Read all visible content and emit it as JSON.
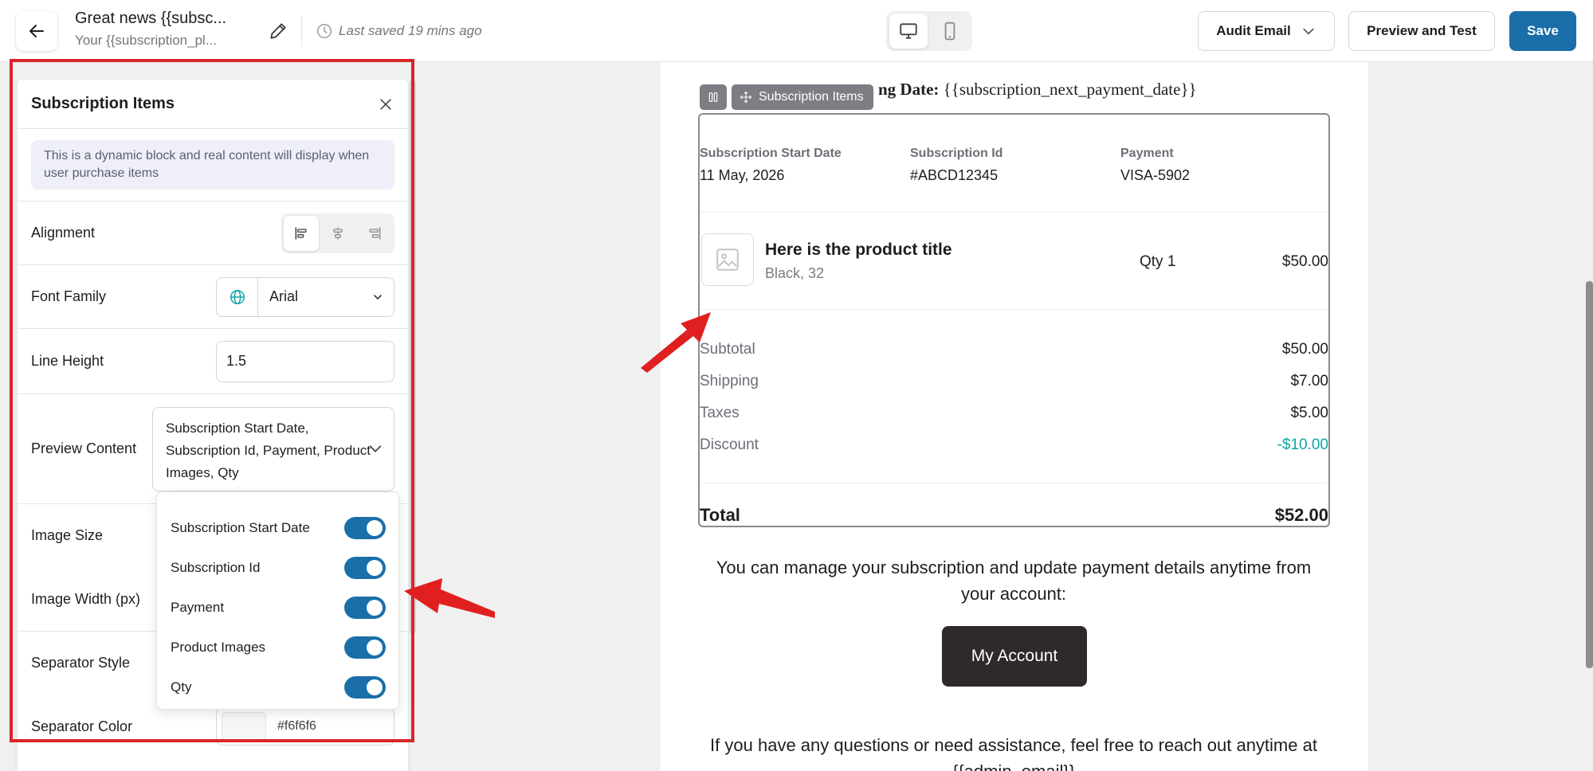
{
  "topbar": {
    "title": "Great news {{subsc...",
    "subtitle": "Your {{subscription_pl...",
    "saved": "Last saved 19 mins ago",
    "audit_label": "Audit Email",
    "preview_label": "Preview and Test",
    "save_label": "Save"
  },
  "panel": {
    "title": "Subscription Items",
    "info": "This is a dynamic block and real content will display when user purchase items",
    "alignment_label": "Alignment",
    "font_family_label": "Font Family",
    "font_family_value": "Arial",
    "line_height_label": "Line Height",
    "line_height_value": "1.5",
    "preview_content_label": "Preview Content",
    "preview_content_value": "Subscription Start Date, Subscription Id, Payment, Product Images, Qty",
    "image_size_label": "Image Size",
    "image_width_label": "Image Width (px)",
    "separator_style_label": "Separator Style",
    "separator_color_label": "Separator Color",
    "separator_color_value": "#f6f6f6",
    "dropdown_items": [
      {
        "label": "Subscription Start Date",
        "on": true
      },
      {
        "label": "Subscription Id",
        "on": true
      },
      {
        "label": "Payment",
        "on": true
      },
      {
        "label": "Product Images",
        "on": true
      },
      {
        "label": "Qty",
        "on": true
      }
    ]
  },
  "email": {
    "next_billing_label": "ng Date:",
    "next_billing_value": "{{subscription_next_payment_date}}",
    "block_name": "Subscription Items",
    "meta": [
      {
        "label": "Subscription Start Date",
        "value": "11 May, 2026"
      },
      {
        "label": "Subscription Id",
        "value": "#ABCD12345"
      },
      {
        "label": "Payment",
        "value": "VISA-5902"
      }
    ],
    "product_title": "Here is the product title",
    "product_variant": "Black, 32",
    "product_qty": "Qty 1",
    "product_price": "$50.00",
    "summary": [
      {
        "label": "Subtotal",
        "value": "$50.00"
      },
      {
        "label": "Shipping",
        "value": "$7.00"
      },
      {
        "label": "Taxes",
        "value": "$5.00"
      },
      {
        "label": "Discount",
        "value": "-$10.00"
      }
    ],
    "total_label": "Total",
    "total_value": "$52.00",
    "manage_text": "You can manage your subscription and update payment details anytime from your account:",
    "account_button": "My Account",
    "questions_text": "If you have any questions or need assistance, feel free to reach out anytime at {{admin_email}}"
  },
  "colors": {
    "accent": "#1a6fa8",
    "discount": "#0ea5a0",
    "highlight": "#d9262b"
  },
  "icons": [
    "arrow-left-icon",
    "pencil-icon",
    "clock-icon",
    "desktop-icon",
    "mobile-icon",
    "chevron-down-icon",
    "close-icon",
    "align-left-icon",
    "align-center-icon",
    "align-right-icon",
    "globe-icon",
    "image-placeholder-icon",
    "drag-handle-icon",
    "move-icon"
  ]
}
